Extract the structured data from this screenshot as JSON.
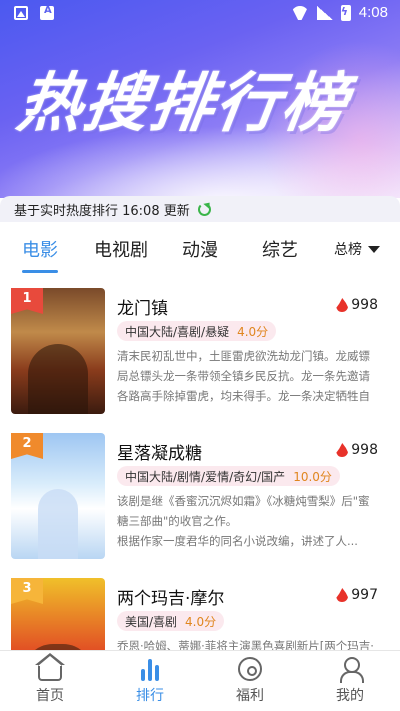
{
  "status_bar": {
    "time": "4:08"
  },
  "hero": {
    "title": "热搜排行榜"
  },
  "update": {
    "text": "基于实时热度排行 16:08 更新"
  },
  "tabs": [
    {
      "label": "电影",
      "active": true
    },
    {
      "label": "电视剧"
    },
    {
      "label": "动漫"
    },
    {
      "label": "综艺"
    }
  ],
  "sort": {
    "label": "总榜"
  },
  "items": [
    {
      "rank": "1",
      "title": "龙门镇",
      "heat": "998",
      "tags": "中国大陆/喜剧/悬疑",
      "score": "4.0分",
      "desc": "清末民初乱世中，土匪雷虎欲洗劫龙门镇。龙威镖局总镖头龙一条带领全镇乡民反抗。龙一条先邀请各路高手除掉雷虎，均未得手。龙一条决定牺牲自己与..."
    },
    {
      "rank": "2",
      "title": "星落凝成糖",
      "heat": "998",
      "tags": "中国大陆/剧情/爱情/奇幻/国产",
      "score": "10.0分",
      "desc": "该剧是继《香蜜沉沉烬如霜》《冰糖炖雪梨》后\"蜜糖三部曲\"的收官之作。\n根据作家一度君华的同名小说改编，讲述了人..."
    },
    {
      "rank": "3",
      "title": "两个玛吉·摩尔",
      "heat": "997",
      "tags": "美国/喜剧",
      "score": "4.0分",
      "desc": "乔恩·哈姆、蒂娜·菲将主演黑色喜剧新片[两个玛吉·摩"
    }
  ],
  "bottom_nav": [
    {
      "label": "首页"
    },
    {
      "label": "排行",
      "active": true
    },
    {
      "label": "福利"
    },
    {
      "label": "我的"
    }
  ],
  "colors": {
    "accent": "#3a8ee6",
    "heat": "#e8322a",
    "score": "#e0861f"
  }
}
